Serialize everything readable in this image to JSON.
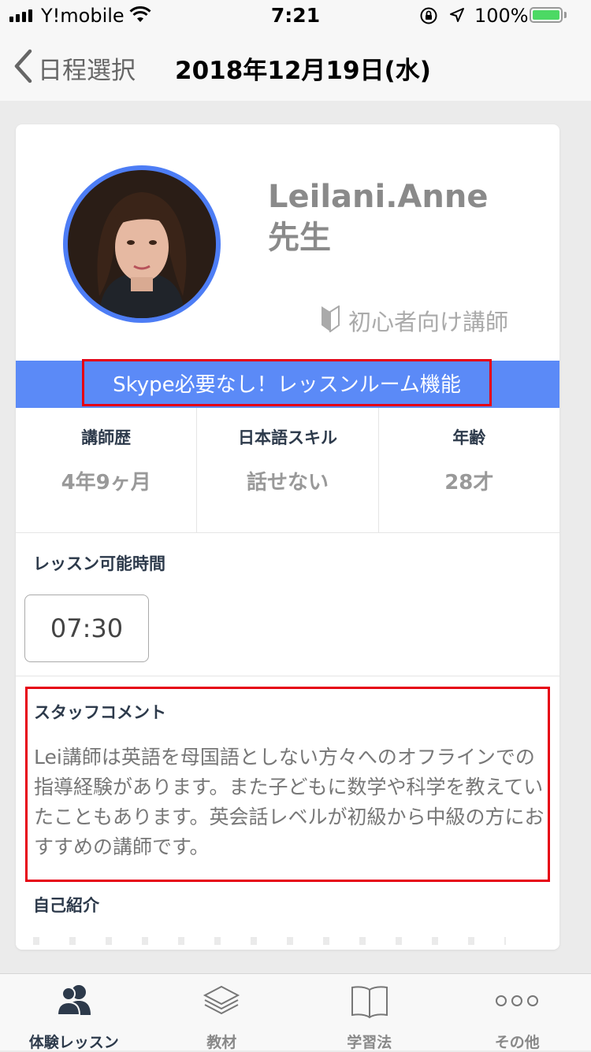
{
  "status_bar": {
    "carrier": "Y!mobile",
    "time": "7:21",
    "battery_percent": "100%",
    "battery_level": 1.0,
    "battery_color": "#4cd964"
  },
  "nav": {
    "back_label": "日程選択",
    "title": "2018年12月19日(水)",
    "icons": {
      "back": "chevron-left-icon"
    }
  },
  "teacher": {
    "name": "Leilani.Anne",
    "honorific": "先生",
    "badge": "初心者向け講師",
    "badge_icon": "beginner-mark-icon"
  },
  "banner": {
    "text": "Skype必要なし！レッスンルーム機能",
    "color": "#5b8af7"
  },
  "stats": [
    {
      "label": "講師歴",
      "value": "4年9ヶ月"
    },
    {
      "label": "日本語スキル",
      "value": "話せない"
    },
    {
      "label": "年齢",
      "value": "28才"
    }
  ],
  "availability": {
    "title": "レッスン可能時間",
    "slots": [
      "07:30"
    ]
  },
  "staff_comment": {
    "title": "スタッフコメント",
    "body": "Lei講師は英語を母国語としない方々へのオフラインでの指導経験があります。また子どもに数学や科学を教えていたこともあります。英会話レベルが初級から中級の方におすすめの講師です。"
  },
  "intro": {
    "title": "自己紹介"
  },
  "tabs": [
    {
      "label": "体験レッスン",
      "icon": "people-icon",
      "active": true
    },
    {
      "label": "教材",
      "icon": "layers-icon",
      "active": false
    },
    {
      "label": "学習法",
      "icon": "book-icon",
      "active": false
    },
    {
      "label": "その他",
      "icon": "more-icon",
      "active": false
    }
  ],
  "colors": {
    "accent_blue": "#5b8af7",
    "highlight_red": "#e60012",
    "heading_navy": "#2d3a4b"
  }
}
